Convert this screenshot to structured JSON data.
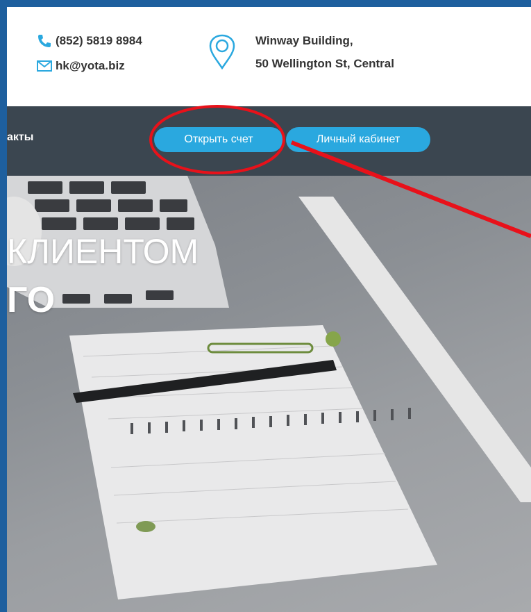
{
  "header": {
    "phone": "(852) 5819 8984",
    "email": "hk@yota.biz",
    "address_line1": "Winway Building,",
    "address_line2": "50 Wellington St, Central"
  },
  "nav": {
    "partial_link": "акты",
    "open_account": "Открыть счет",
    "cabinet": "Личный кабинет"
  },
  "hero": {
    "line1": "КЛИЕНТОМ",
    "line2": "ГО"
  },
  "colors": {
    "accent": "#2aa8df",
    "nav_bg": "#3b4650",
    "annotation": "#e8111a",
    "frame": "#1e5f9e"
  },
  "icons": {
    "phone": "phone-icon",
    "email": "envelope-icon",
    "address": "location-pin-icon"
  }
}
